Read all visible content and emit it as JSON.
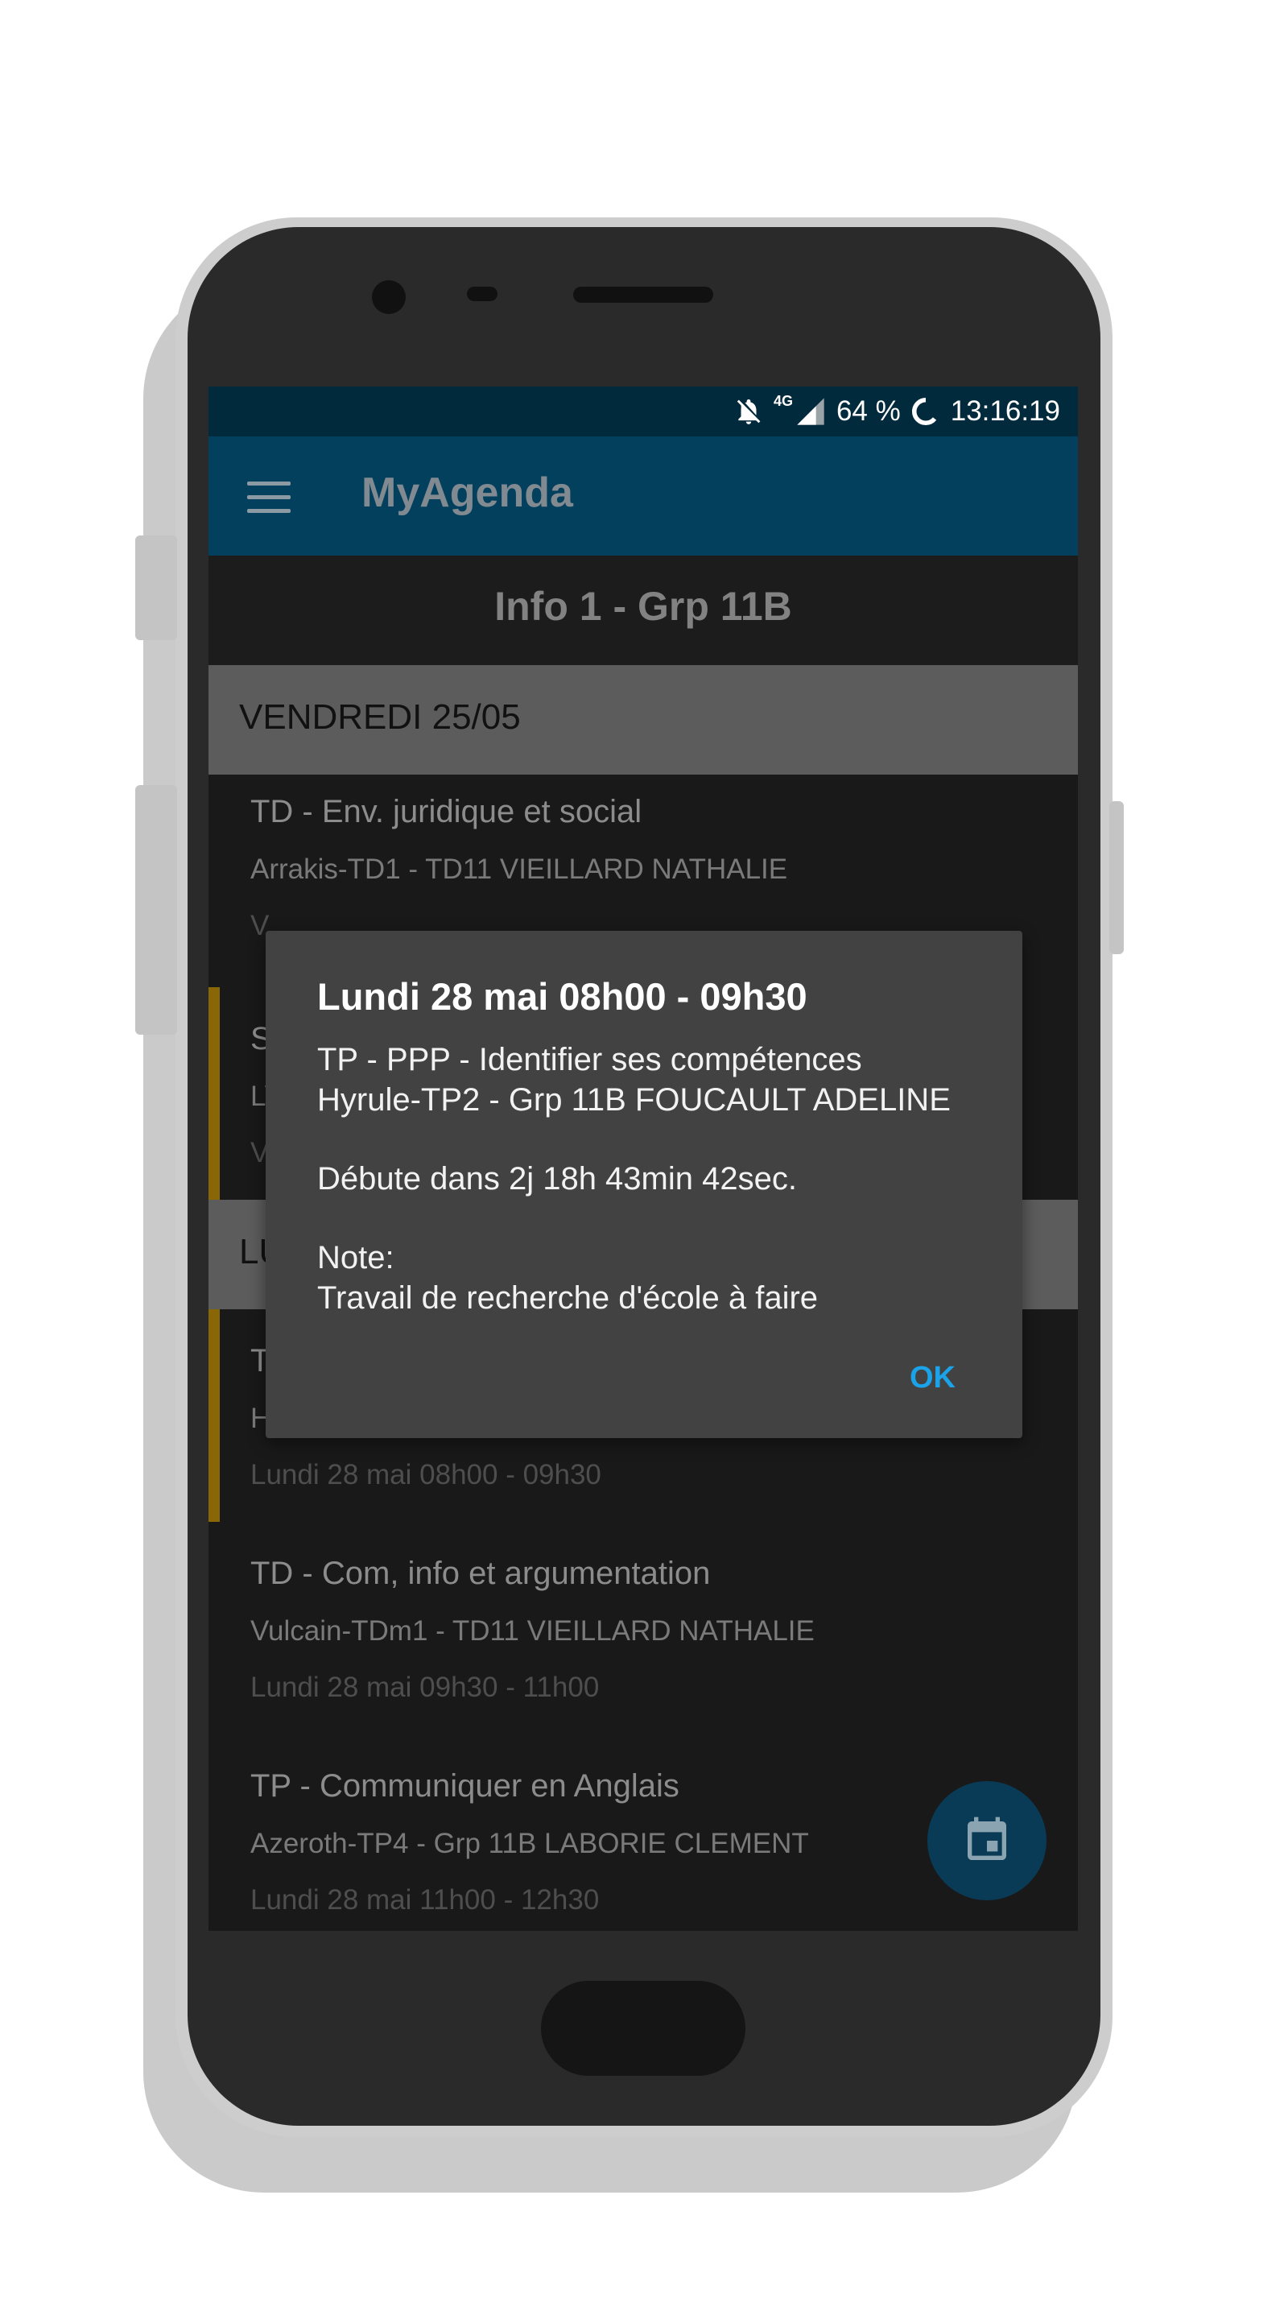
{
  "status_bar": {
    "network": "4G",
    "battery": "64 %",
    "time": "13:16:19"
  },
  "app_bar": {
    "title": "MyAgenda"
  },
  "group_title": "Info 1 - Grp 11B",
  "days": [
    {
      "label": "VENDREDI 25/05",
      "courses": [
        {
          "title": "TD - Env. juridique et social",
          "room_teacher": "Arrakis-TD1 - TD11 VIEILLARD NATHALIE",
          "time_partial": "V"
        },
        {
          "title_partial": "S",
          "room_partial": "LY",
          "time_partial": "V"
        }
      ]
    },
    {
      "label_partial": "LU",
      "courses": [
        {
          "title_partial": "T",
          "room_partial": "H",
          "time": "Lundi 28 mai 08h00 - 09h30"
        },
        {
          "title": "TD - Com, info et argumentation",
          "room_teacher": "Vulcain-TDm1 - TD11 VIEILLARD NATHALIE",
          "time": "Lundi 28 mai 09h30 - 11h00"
        },
        {
          "title": "TP - Communiquer en Anglais",
          "room_teacher": "Azeroth-TP4 - Grp 11B LABORIE CLEMENT",
          "time": "Lundi 28 mai 11h00 - 12h30"
        }
      ]
    }
  ],
  "dialog": {
    "title": "Lundi 28 mai 08h00 - 09h30",
    "course": "TP - PPP - Identifier ses compétences",
    "room_teacher": "Hyrule-TP2 - Grp 11B FOUCAULT ADELINE",
    "countdown": "Débute dans 2j 18h 43min 42sec.",
    "note_label": "Note:",
    "note_text": "Travail de recherche d'école à faire",
    "ok_label": "OK"
  },
  "icons": {
    "status": [
      "notifications-off-icon",
      "signal-icon",
      "battery-ring-icon"
    ],
    "menu": "menu-icon",
    "fab": "calendar-icon"
  },
  "colors": {
    "app_bar": "#02405e",
    "status_bar": "#022a3d",
    "accent": "#8a6706",
    "ok": "#1aa3e8"
  }
}
